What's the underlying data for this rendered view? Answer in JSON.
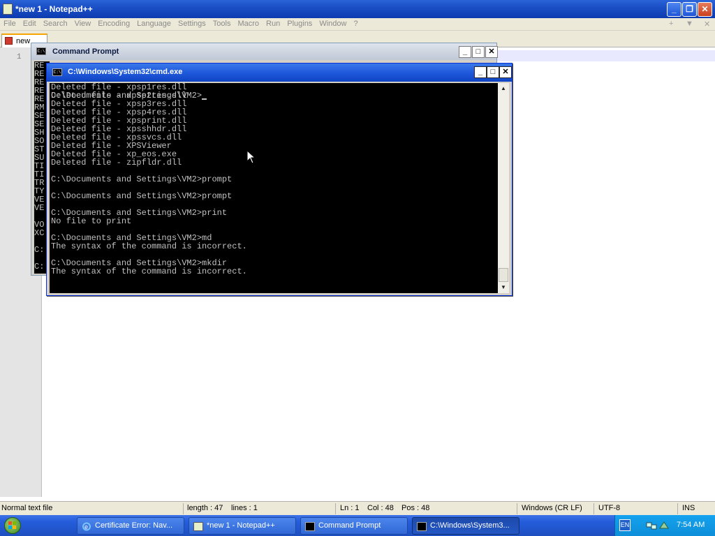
{
  "notepad": {
    "title": "*new 1 - Notepad++",
    "menu": [
      "File",
      "Edit",
      "Search",
      "View",
      "Encoding",
      "Language",
      "Settings",
      "Tools",
      "Macro",
      "Run",
      "Plugins",
      "Window",
      "?"
    ],
    "menu_right": {
      "plus": "+",
      "dropdown": "▼",
      "close": "✕"
    },
    "tab_label": "new",
    "line_number": "1",
    "status": {
      "file_type": "Normal text file",
      "length": "length : 47",
      "lines": "lines : 1",
      "ln": "Ln : 1",
      "col": "Col : 48",
      "pos": "Pos : 48",
      "eol": "Windows (CR LF)",
      "encoding": "UTF-8",
      "mode": "INS"
    },
    "window_controls": {
      "minimize": "_",
      "restore": "❐",
      "close": "✕"
    }
  },
  "command_prompt_bg": {
    "title": "Command Prompt",
    "console_lines": [
      "RE",
      "RE",
      "RE",
      "RE",
      "RE",
      "RM",
      "SE",
      "SE",
      "SH",
      "SO",
      "ST",
      "SU",
      "TI",
      "TI",
      "TR",
      "TY",
      "VE",
      "VE",
      "",
      "VO",
      "XC",
      "",
      "C:",
      "",
      "C:"
    ],
    "controls": {
      "minimize": "_",
      "maximize": "□",
      "close": "✕"
    }
  },
  "cmd_window": {
    "title": "C:\\Windows\\System32\\cmd.exe",
    "console_lines": [
      "Deleted file - xpsp1res.dll",
      "Deleted file - xpsp2res.dll",
      "Deleted file - xpsp3res.dll",
      "Deleted file - xpsp4res.dll",
      "Deleted file - xpsprint.dll",
      "Deleted file - xpsshhdr.dll",
      "Deleted file - xpssvcs.dll",
      "Deleted file - XPSViewer",
      "Deleted file - xp_eos.exe",
      "Deleted file - zipfldr.dll",
      "",
      "C:\\Documents and Settings\\VM2>prompt",
      "",
      "C:\\Documents and Settings\\VM2>prompt",
      "",
      "C:\\Documents and Settings\\VM2>print",
      "No file to print",
      "",
      "C:\\Documents and Settings\\VM2>md",
      "The syntax of the command is incorrect.",
      "",
      "C:\\Documents and Settings\\VM2>mkdir",
      "The syntax of the command is incorrect.",
      ""
    ],
    "prompt_line": "C:\\Documents and Settings\\VM2>",
    "controls": {
      "minimize": "_",
      "maximize": "□",
      "close": "✕"
    },
    "scroll": {
      "up": "▲",
      "down": "▼"
    }
  },
  "taskbar": {
    "buttons": [
      {
        "label": "Certificate Error: Nav...",
        "icon": "ie-icon"
      },
      {
        "label": "*new 1 - Notepad++",
        "icon": "notepad-icon"
      },
      {
        "label": "Command Prompt",
        "icon": "cmd-icon"
      },
      {
        "label": "C:\\Windows\\System3...",
        "icon": "cmd-icon"
      }
    ],
    "lang": "EN",
    "clock": "7:54 AM"
  },
  "colors": {
    "xp_blue": "#245ddb",
    "console_bg": "#000000",
    "console_fg": "#c0c0c0",
    "tray": "#0e8ed8"
  }
}
